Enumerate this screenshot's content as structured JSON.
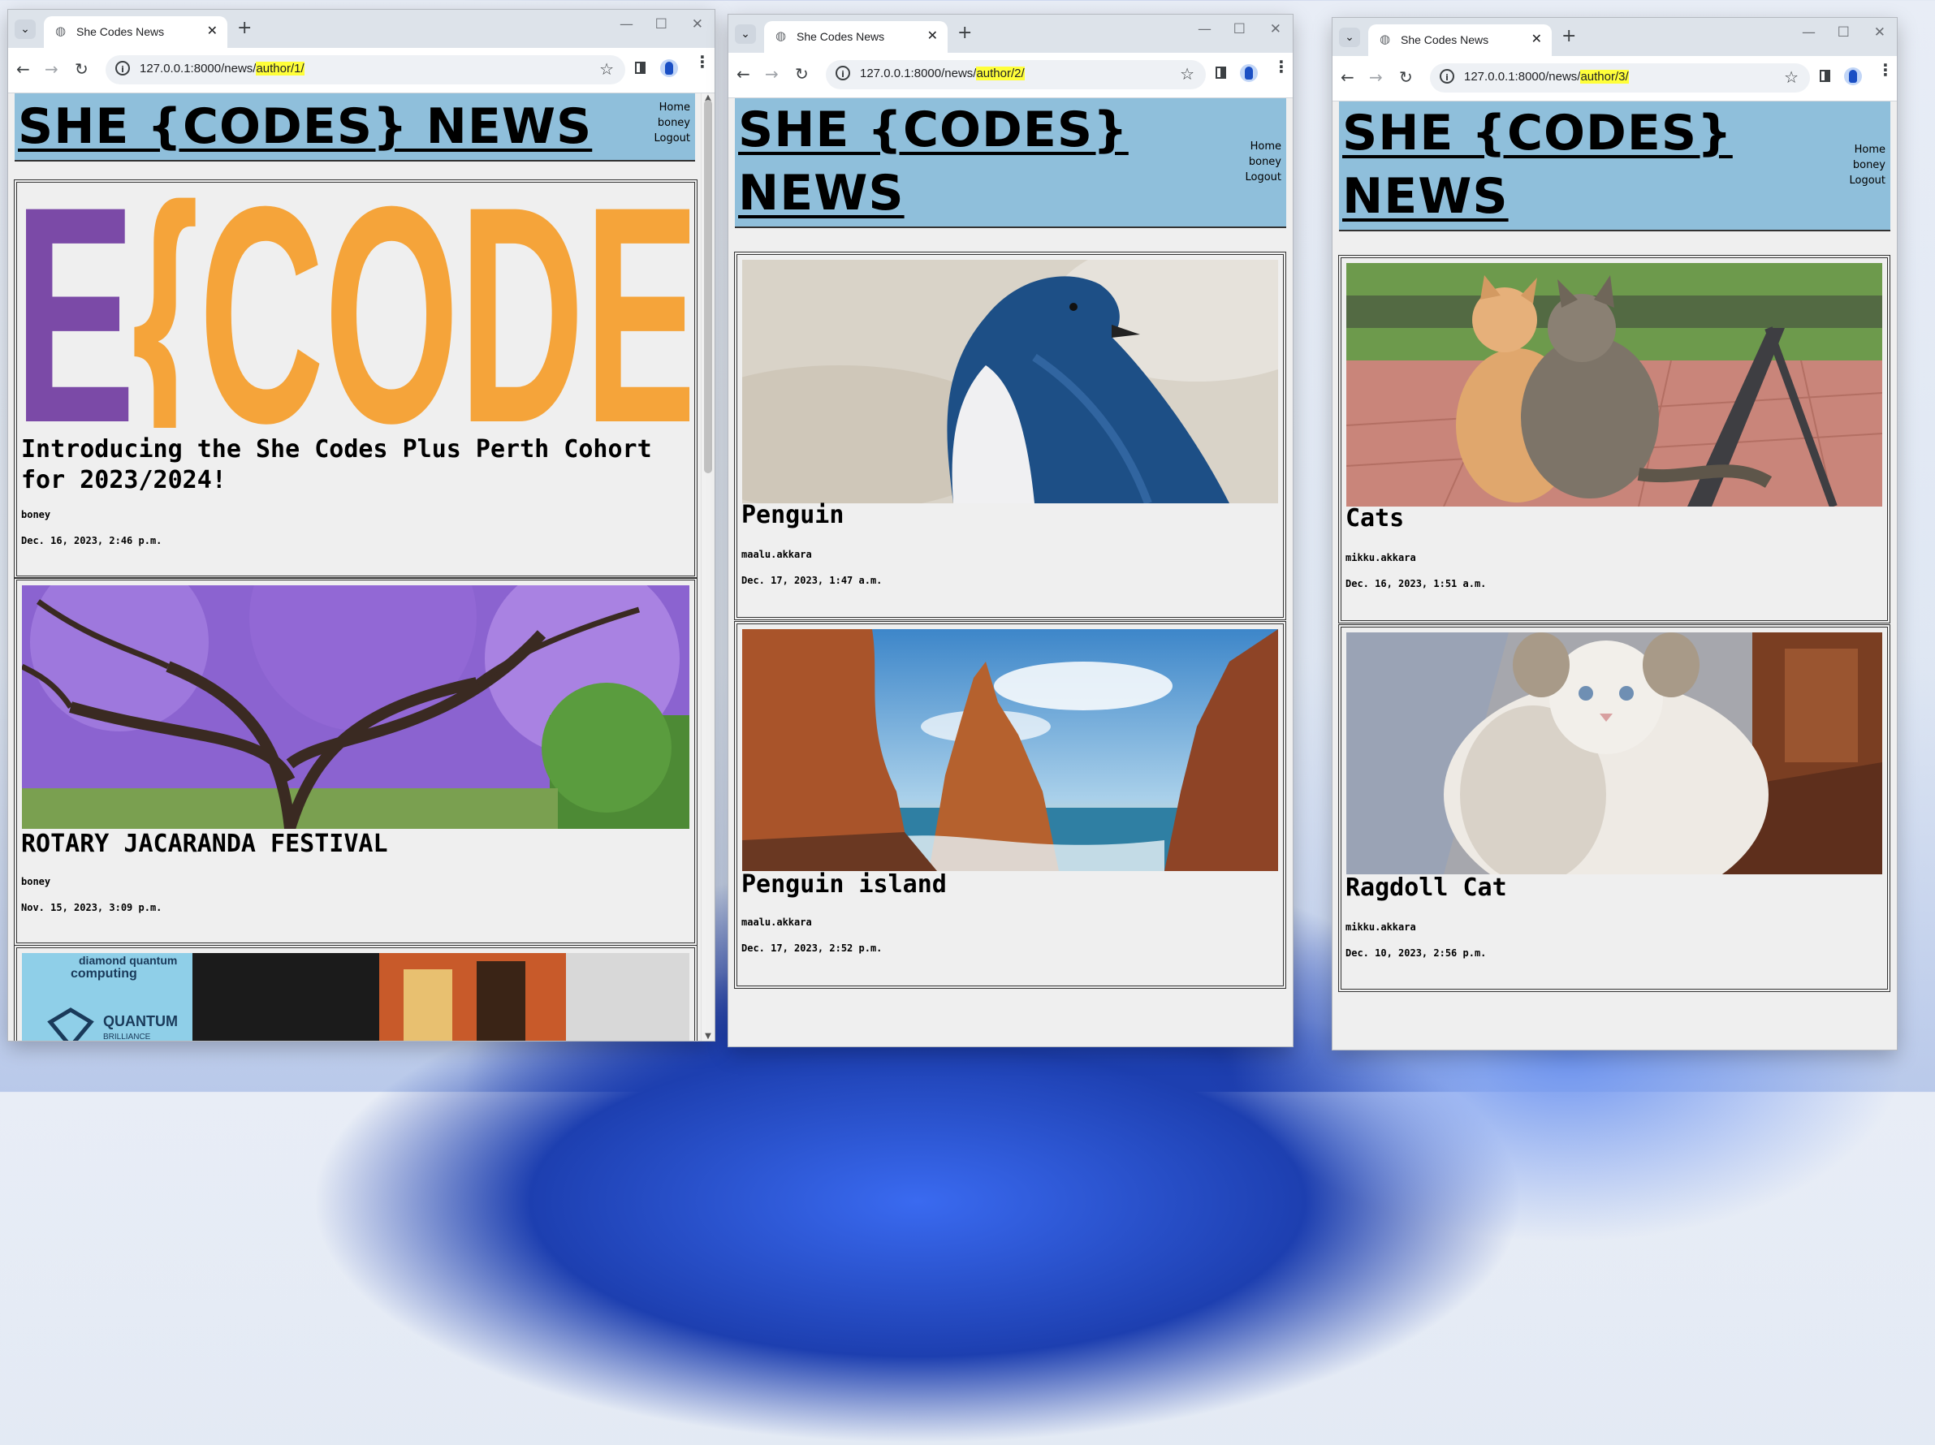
{
  "windows": [
    {
      "tab_title": "She Codes News",
      "url_prefix": "127.0.0.1:8000/news/",
      "url_highlight": "author/1/",
      "site_title": "SHE {CODES} NEWS",
      "nav": [
        "Home",
        "boney",
        "Logout"
      ],
      "stories": [
        {
          "title": "Introducing the She Codes Plus Perth Cohort for 2023/2024!",
          "author": "boney",
          "date": "Dec. 16, 2023, 2:46 p.m.",
          "image": "she-codes-logo",
          "logo_text": "E{CODE"
        },
        {
          "title": "ROTARY JACARANDA FESTIVAL",
          "author": "boney",
          "date": "Nov. 15, 2023, 3:09 p.m.",
          "image": "jacaranda-tree"
        },
        {
          "title": "",
          "author": "",
          "date": "",
          "image": "quantum-computer",
          "image_text_1": "computing",
          "image_text_2": "QUANTUM",
          "image_text_3": "BRILLIANCE",
          "image_text_0": "diamond quantum"
        }
      ]
    },
    {
      "tab_title": "She Codes News",
      "url_prefix": "127.0.0.1:8000/news/",
      "url_highlight": "author/2/",
      "site_title_line1": "SHE {CODES}",
      "site_title_line2": "NEWS",
      "nav": [
        "Home",
        "boney",
        "Logout"
      ],
      "stories": [
        {
          "title": "Penguin",
          "author": "maalu.akkara",
          "date": "Dec. 17, 2023, 1:47 a.m.",
          "image": "little-penguin"
        },
        {
          "title": "Penguin island",
          "author": "maalu.akkara",
          "date": "Dec. 17, 2023, 2:52 p.m.",
          "image": "rocky-coast"
        }
      ]
    },
    {
      "tab_title": "She Codes News",
      "url_prefix": "127.0.0.1:8000/news/",
      "url_highlight": "author/3/",
      "site_title_line1": "SHE {CODES}",
      "site_title_line2": "NEWS",
      "nav": [
        "Home",
        "boney",
        "Logout"
      ],
      "stories": [
        {
          "title": "Cats",
          "author": "mikku.akkara",
          "date": "Dec. 16, 2023, 1:51 a.m.",
          "image": "two-kittens"
        },
        {
          "title": "Ragdoll Cat",
          "author": "mikku.akkara",
          "date": "Dec. 10, 2023, 2:56 p.m.",
          "image": "ragdoll-cat"
        }
      ]
    }
  ],
  "icons": {
    "tab_list": "chevron-down-icon",
    "favicon": "globe-icon",
    "back": "arrow-left-icon",
    "forward": "arrow-right-icon",
    "reload": "reload-icon",
    "site_info": "info-icon",
    "bookmark": "star-icon",
    "side_panel": "side-panel-icon",
    "profile": "profile-icon",
    "menu": "more-vert-icon"
  },
  "colors": {
    "header_bg": "#8fbfdb",
    "page_bg": "#efefef",
    "url_highlight": "#ffff3a",
    "logo_purple": "#7b4aa7",
    "logo_orange": "#f5a43a"
  }
}
